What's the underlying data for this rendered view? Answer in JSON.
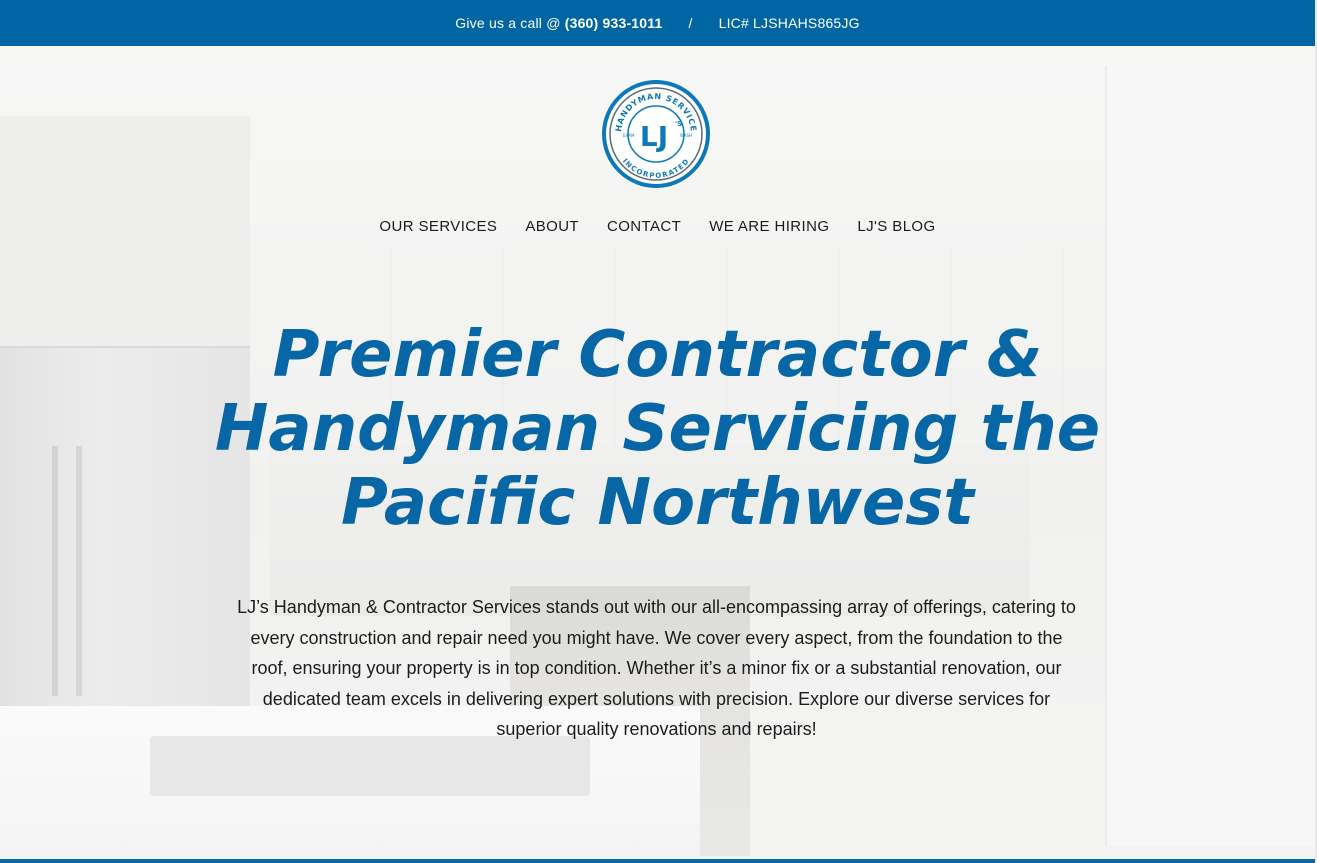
{
  "topbar": {
    "call_prefix": "Give us a call @",
    "phone": "(360) 933-1011",
    "separator": "/",
    "license": "LIC# LJSHAHS865JG"
  },
  "logo": {
    "ring_text_top": "HANDYMAN SERVICE",
    "ring_text_bottom": "INCORPORATED",
    "monogram": "LJ",
    "monogram_suffix": "'S",
    "left_small": "EXAM",
    "right_small": "WASH"
  },
  "nav": {
    "items": [
      {
        "label": "OUR SERVICES"
      },
      {
        "label": "ABOUT"
      },
      {
        "label": "CONTACT"
      },
      {
        "label": "WE ARE HIRING"
      },
      {
        "label": "LJ'S BLOG"
      }
    ]
  },
  "hero": {
    "headline": "Premier Contractor & Handyman Servicing the Pacific Northwest",
    "intro": "LJ’s Handyman & Contractor Services stands out with our all-encompassing array of offerings, catering to every construction and repair need you might have. We cover every aspect, from the foundation to the roof, ensuring your property is in top condition. Whether it’s a minor fix or a substantial renovation, our dedicated team excels in delivering expert solutions with precision. Explore our diverse services for superior quality renovations and repairs!"
  },
  "colors": {
    "brand_blue": "#0065a3",
    "headline_blue": "#0767a6",
    "text": "#1c1c1c"
  }
}
